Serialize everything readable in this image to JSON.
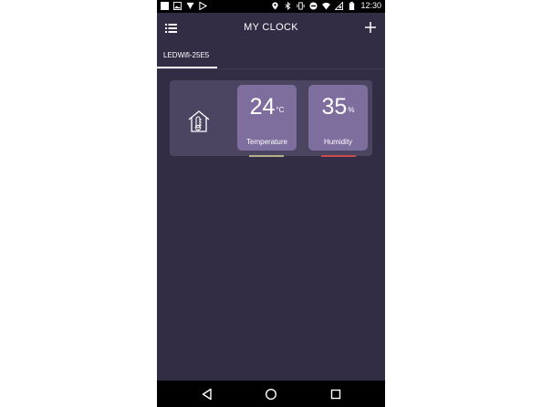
{
  "status_bar": {
    "time": "12:30",
    "icons_left": [
      "square-icon",
      "image-icon",
      "download-icon",
      "play-store-icon"
    ],
    "icons_right": [
      "location-icon",
      "bluetooth-icon",
      "vibrate-icon",
      "do-not-disturb-icon",
      "wifi-icon",
      "no-signal-icon",
      "battery-icon"
    ]
  },
  "app_bar": {
    "title": "MY CLOCK",
    "menu_icon": "menu-icon",
    "add_icon": "add-icon"
  },
  "tabs": [
    {
      "label": "LEDWifi-25E5",
      "selected": true
    }
  ],
  "device_card": {
    "icon": "house-thermometer-icon",
    "tiles": [
      {
        "value": "24",
        "unit": "°C",
        "label": "Temperature",
        "bar_color": "#b6b08a"
      },
      {
        "value": "35",
        "unit": "%",
        "label": "Humidity",
        "bar_color": "#c94a4f"
      }
    ]
  },
  "nav_bar": {
    "buttons": [
      "back-icon",
      "home-icon",
      "recent-apps-icon"
    ]
  },
  "colors": {
    "background": "#322c45",
    "card": "#4b4561",
    "tile": "#7d6e9e"
  }
}
